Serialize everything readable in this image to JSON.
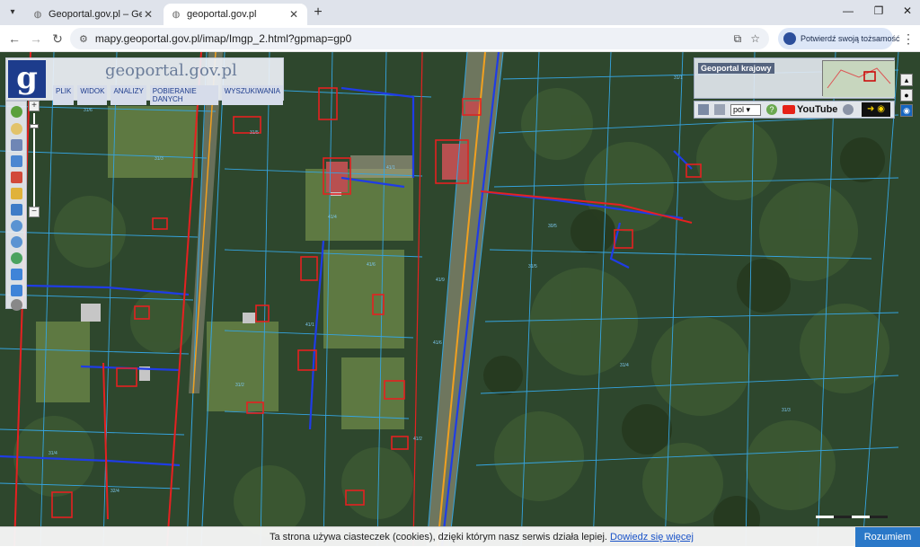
{
  "browser": {
    "tabs": [
      {
        "title": "Geoportal.gov.pl – Geoportal In",
        "active": false
      },
      {
        "title": "geoportal.gov.pl",
        "active": true
      }
    ],
    "url": "mapy.geoportal.gov.pl/imap/Imgp_2.html?gpmap=gp0",
    "identity_label": "Potwierdź swoją tożsamość",
    "icons": {
      "tab_menu": "chevron-down-icon",
      "new_tab": "plus-icon",
      "back": "arrow-left-icon",
      "forward": "arrow-right-icon",
      "reload": "reload-icon",
      "site_info": "tune-icon",
      "install": "install-icon",
      "bookmark": "star-icon",
      "menu": "kebab-icon"
    }
  },
  "app": {
    "logo_text": "geoportal.gov.pl",
    "menu": [
      "PLIK",
      "WIDOK",
      "ANALIZY",
      "POBIERANIE DANYCH",
      "WYSZUKIWANIA"
    ],
    "overview_label": "Geoportal krajowy",
    "language": "pol",
    "youtube_label": "YouTube",
    "zoom_in": "+",
    "zoom_out": "−"
  },
  "cookie": {
    "message": "Ta strona używa ciasteczek (cookies), dzięki którym nasz serwis działa lepiej.",
    "link": "Dowiedz się więcej",
    "accept": "Rozumiem"
  },
  "colors": {
    "parcel_lines": "#2f9ad8",
    "building_outlines": "#e52121",
    "utility_lines": "#1f3ce6",
    "road_line": "#f0a020",
    "forest": "#2d4a2c"
  }
}
